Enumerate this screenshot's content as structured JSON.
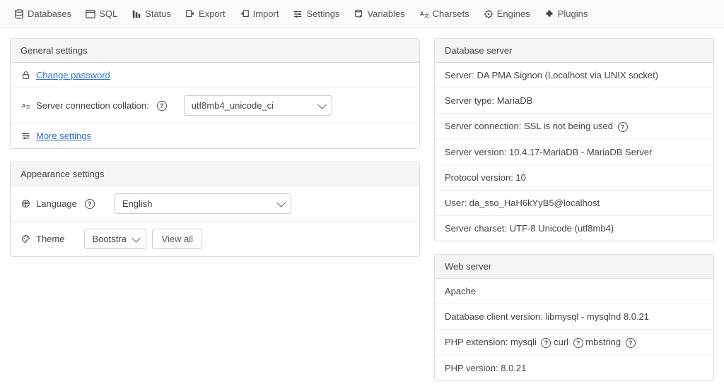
{
  "topnav": [
    {
      "label": "Databases",
      "icon": "database-icon"
    },
    {
      "label": "SQL",
      "icon": "sql-icon"
    },
    {
      "label": "Status",
      "icon": "status-icon"
    },
    {
      "label": "Export",
      "icon": "export-icon"
    },
    {
      "label": "Import",
      "icon": "import-icon"
    },
    {
      "label": "Settings",
      "icon": "settings-icon"
    },
    {
      "label": "Variables",
      "icon": "variables-icon"
    },
    {
      "label": "Charsets",
      "icon": "charsets-icon"
    },
    {
      "label": "Engines",
      "icon": "engines-icon"
    },
    {
      "label": "Plugins",
      "icon": "plugins-icon"
    }
  ],
  "general": {
    "title": "General settings",
    "change_password": "Change password",
    "collation_label": "Server connection collation:",
    "collation_value": "utf8mb4_unicode_ci",
    "more_settings": "More settings"
  },
  "appearance": {
    "title": "Appearance settings",
    "language_label": "Language",
    "language_value": "English",
    "theme_label": "Theme",
    "theme_value": "Bootstrap",
    "view_all": "View all"
  },
  "dbserver": {
    "title": "Database server",
    "rows": [
      "Server: DA PMA Signon (Localhost via UNIX socket)",
      "Server type: MariaDB",
      "Server connection: SSL is not being used",
      "Server version: 10.4.17-MariaDB - MariaDB Server",
      "Protocol version: 10",
      "User: da_sso_HaH6kYyB5@localhost",
      "Server charset: UTF-8 Unicode (utf8mb4)"
    ]
  },
  "webserver": {
    "title": "Web server",
    "apache": "Apache",
    "dbclient": "Database client version: libmysql - mysqlnd 8.0.21",
    "phpext_label": "PHP extension:",
    "phpext_items": [
      "mysqli",
      "curl",
      "mbstring"
    ],
    "phpver": "PHP version: 8.0.21"
  }
}
